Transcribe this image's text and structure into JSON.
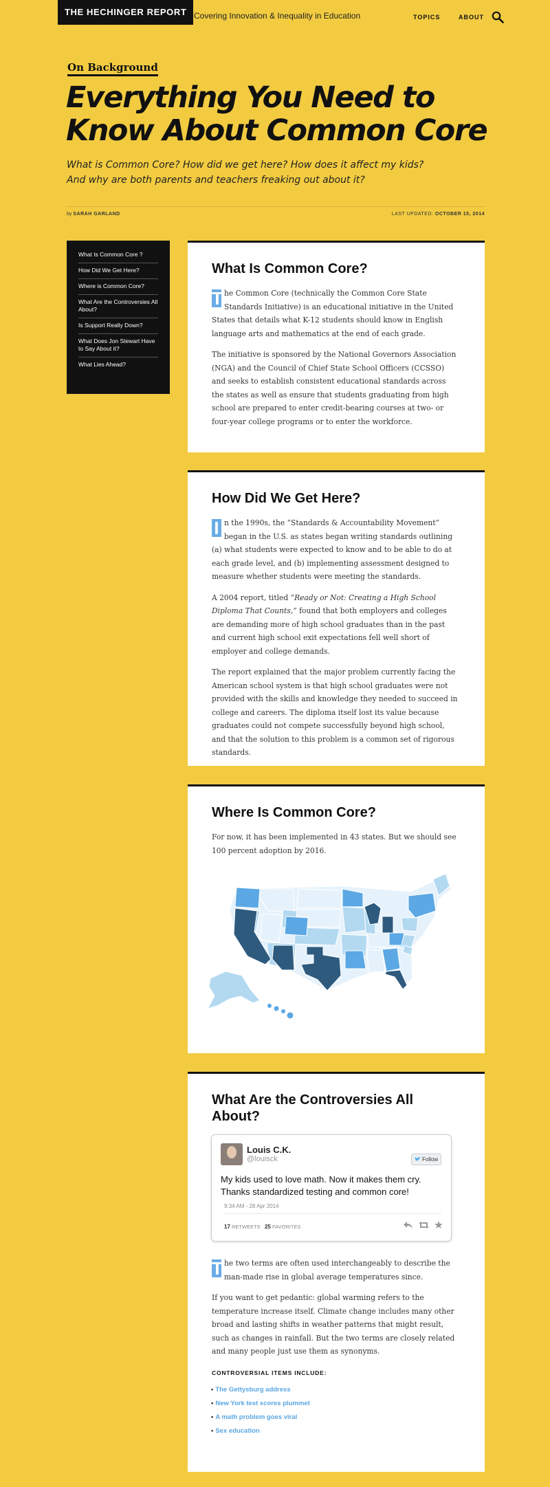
{
  "header": {
    "logo": "THE HECHINGER REPORT",
    "tagline": "Covering Innovation & Inequality in Education",
    "nav": [
      "TOPICS",
      "ABOUT"
    ]
  },
  "article": {
    "kicker": "On Background",
    "title": "Everything You Need to Know About Common Core",
    "dek": "What is Common Core? How did we get here? How does it affect my kids? And why are both parents and teachers freaking out about it?",
    "byline_prefix": "by",
    "author": "SARAH GARLAND",
    "updated_label": "LAST UPDATED:",
    "updated_date": "OCTOBER 15, 2014"
  },
  "toc": [
    "What Is Common Core ?",
    "How Did We Get Here?",
    "Where is Common Core?",
    "What Are the Controversies All About?",
    "Is Support Really Down?",
    "What Does Jon Stewart Have to Say About it?",
    "What Lies Ahead?"
  ],
  "sections": {
    "s1": {
      "title": "What Is Common Core?",
      "dropcap": "T",
      "p1": "he Common Core (technically the Common Core State Standards Initiative) is an educational initiative in the United States that details what K-12 students should know in English language arts and mathematics at the end of each grade.",
      "p2": "The initiative is sponsored by the National Governors Association (NGA) and the Council of Chief State School Officers (CCSSO) and seeks to establish consistent educational standards across the states as well as ensure that students graduating from high school are prepared to enter credit-bearing courses at two- or four-year college programs or to enter the workforce."
    },
    "s2": {
      "title": "How Did We Get Here?",
      "dropcap": "I",
      "p1": "n the 1990s, the “Standards & Accountability Movement” began in the U.S. as states began writing standards outlining (a) what students were expected to know and to be able to do at each grade level, and (b) implementing assessment designed to measure whether students were meeting the standards.",
      "p2_a": "A 2004 report, titled ",
      "p2_title": "“Ready or Not: Creating a High School Diploma That Counts,”",
      "p2_b": " found that both employers and colleges are demanding more of high school graduates than in the past and current high school exit expectations fell well short of employer and college demands.",
      "p3": "The report explained that the major problem currently facing the American school system is that high school graduates were not provided with the skills and knowledge they needed to succeed in college and careers. The diploma itself lost its value because graduates could not compete successfully beyond high school, and that the solution to this problem is a common set of rigorous standards."
    },
    "s3": {
      "title": "Where Is Common Core?",
      "p1": "For now, it has been implemented in 43 states. But we should see 100 percent adoption by 2016."
    },
    "s4": {
      "title": "What Are the Controversies All About?",
      "tweet": {
        "name": "Louis C.K.",
        "handle": "@louisck",
        "follow": "Follow",
        "text": "My kids used to love math. Now it makes them cry. Thanks standardized testing and common core!",
        "time": "9:34 AM - 28 Apr 2014",
        "retweets": "17",
        "retweets_label": "RETWEETS",
        "favorites": "25",
        "favorites_label": "FAVORITES"
      },
      "dropcap": "T",
      "p1": "he two terms are often used interchangeably to describe the man-made rise in global average temperatures since.",
      "p2": "If you want to get pedantic: global warming refers to the  temperature increase itself. Climate change includes many other broad and lasting shifts in weather patterns that might result, such as changes in rainfall. But the two terms are closely related and many people just use them as synonyms.",
      "list_head": "CONTROVERSIAL ITEMS INCLUDE:",
      "items": [
        "The Gettysburg address",
        "New York test scores plummet",
        "A math problem goes viral",
        "Sex education"
      ]
    }
  },
  "colors": {
    "background": "#f2cb41",
    "accent_blue": "#6aace6",
    "map_light": "#e6f2fb",
    "map_mid": "#b3d9f1",
    "map_blue": "#5ba8e4",
    "map_dark": "#2e5a7e"
  },
  "icons": [
    "search-icon",
    "twitter-bird-icon",
    "reply-icon",
    "retweet-icon",
    "favorite-star-icon"
  ]
}
